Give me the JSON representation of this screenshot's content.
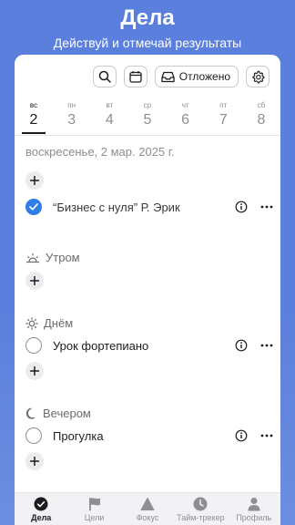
{
  "header": {
    "title": "Дела",
    "subtitle": "Действуй и отмечай результаты"
  },
  "toolbar": {
    "postponed_label": "Отложено",
    "icons": [
      "search-icon",
      "calendar-icon",
      "inbox-icon",
      "gear-icon"
    ]
  },
  "week": {
    "days": [
      {
        "name": "вс",
        "num": "2",
        "active": true
      },
      {
        "name": "пн",
        "num": "3"
      },
      {
        "name": "вт",
        "num": "4"
      },
      {
        "name": "ср",
        "num": "5"
      },
      {
        "name": "чт",
        "num": "6"
      },
      {
        "name": "пт",
        "num": "7"
      },
      {
        "name": "сб",
        "num": "8"
      }
    ]
  },
  "date_label": "воскресенье, 2 мар. 2025 г.",
  "tasks": {
    "general": [
      {
        "text": "“Бизнес с нуля” Р. Эрик",
        "done": true
      }
    ],
    "morning": {
      "label": "Утром",
      "items": []
    },
    "day": {
      "label": "Днём",
      "items": [
        {
          "text": "Урок фортепиано",
          "done": false
        }
      ]
    },
    "evening": {
      "label": "Вечером",
      "items": [
        {
          "text": "Прогулка",
          "done": false
        }
      ]
    }
  },
  "tabs": [
    {
      "label": "Дела",
      "icon": "check-circle-icon",
      "active": true
    },
    {
      "label": "Цели",
      "icon": "flag-icon"
    },
    {
      "label": "Фокус",
      "icon": "triangle-icon"
    },
    {
      "label": "Тайм-трекер",
      "icon": "clock-icon"
    },
    {
      "label": "Профиль",
      "icon": "person-icon"
    }
  ],
  "colors": {
    "background": "#5b7fdc",
    "accent": "#2f7de6",
    "card": "#ffffff"
  }
}
